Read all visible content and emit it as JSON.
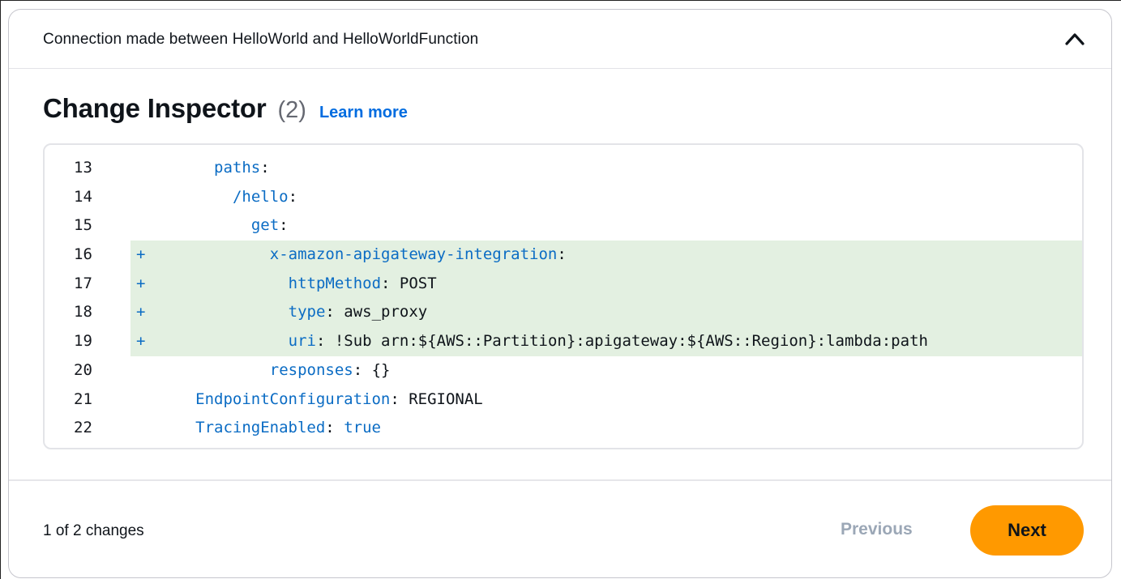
{
  "header": {
    "title": "Connection made between HelloWorld and HelloWorldFunction",
    "collapse_icon": "chevron-up-icon"
  },
  "inspector": {
    "title": "Change Inspector",
    "count": "(2)",
    "learn_more": "Learn more"
  },
  "code": {
    "lines": [
      {
        "no": "13",
        "mark": "",
        "added": false,
        "indent": "         ",
        "key": "paths",
        "rest": ":"
      },
      {
        "no": "14",
        "mark": "",
        "added": false,
        "indent": "           ",
        "key": "/hello",
        "rest": ":"
      },
      {
        "no": "15",
        "mark": "",
        "added": false,
        "indent": "             ",
        "key": "get",
        "rest": ":"
      },
      {
        "no": "16",
        "mark": "+",
        "added": true,
        "indent": "               ",
        "key": "x-amazon-apigateway-integration",
        "rest": ":"
      },
      {
        "no": "17",
        "mark": "+",
        "added": true,
        "indent": "                 ",
        "key": "httpMethod",
        "rest": ": POST"
      },
      {
        "no": "18",
        "mark": "+",
        "added": true,
        "indent": "                 ",
        "key": "type",
        "rest": ": aws_proxy"
      },
      {
        "no": "19",
        "mark": "+",
        "added": true,
        "indent": "                 ",
        "key": "uri",
        "rest": ": !Sub arn:${AWS::Partition}:apigateway:${AWS::Region}:lambda:path"
      },
      {
        "no": "20",
        "mark": "",
        "added": false,
        "indent": "               ",
        "key": "responses",
        "rest": ": {}"
      },
      {
        "no": "21",
        "mark": "",
        "added": false,
        "indent": "       ",
        "key": "EndpointConfiguration",
        "rest": ": REGIONAL"
      },
      {
        "no": "22",
        "mark": "",
        "added": false,
        "indent": "       ",
        "key": "TracingEnabled",
        "rest": ": ",
        "val_blue": "true"
      }
    ]
  },
  "footer": {
    "status": "1 of 2 changes",
    "previous_label": "Previous",
    "next_label": "Next"
  },
  "colors": {
    "accent": "#ff9900",
    "link": "#006ce0",
    "code_key": "#0b6cc4",
    "added_bg": "#e3f0e1",
    "disabled": "#9ba7b6"
  }
}
